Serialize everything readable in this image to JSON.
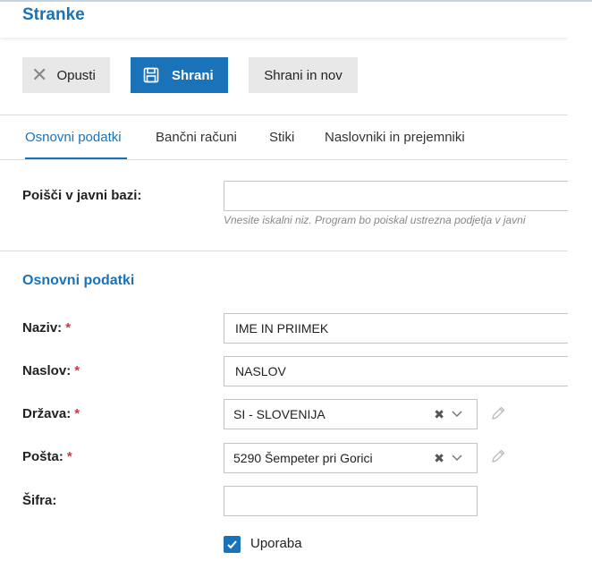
{
  "header": {
    "title": "Stranke"
  },
  "toolbar": {
    "cancel_label": "Opusti",
    "save_label": "Shrani",
    "save_new_label": "Shrani in nov"
  },
  "tabs": [
    {
      "label": "Osnovni podatki",
      "active": true
    },
    {
      "label": "Bančni računi",
      "active": false
    },
    {
      "label": "Stiki",
      "active": false
    },
    {
      "label": "Naslovniki in prejemniki",
      "active": false
    }
  ],
  "search": {
    "label": "Poišči v javni bazi:",
    "value": "",
    "hint": "Vnesite iskalni niz. Program bo poiskal ustrezna podjetja v javni"
  },
  "section": {
    "title": "Osnovni podatki"
  },
  "fields": {
    "naziv": {
      "label": "Naziv:",
      "value": "IME IN PRIIMEK",
      "required": true
    },
    "naslov": {
      "label": "Naslov:",
      "value": "NASLOV",
      "required": true
    },
    "drzava": {
      "label": "Država:",
      "value": "SI - SLOVENIJA",
      "required": true
    },
    "posta": {
      "label": "Pošta:",
      "value": "5290 Šempeter pri Gorici",
      "required": true
    },
    "sifra": {
      "label": "Šifra:",
      "value": "",
      "required": false
    }
  },
  "required_marker": "*",
  "checkbox": {
    "label": "Uporaba",
    "checked": true
  },
  "colors": {
    "accent": "#1a73b8",
    "required": "#dd3333",
    "button_gray": "#e8e8e8"
  },
  "icons": [
    "close-icon",
    "save-icon",
    "clear-icon",
    "chevron-down-icon",
    "pencil-icon",
    "check-icon"
  ]
}
